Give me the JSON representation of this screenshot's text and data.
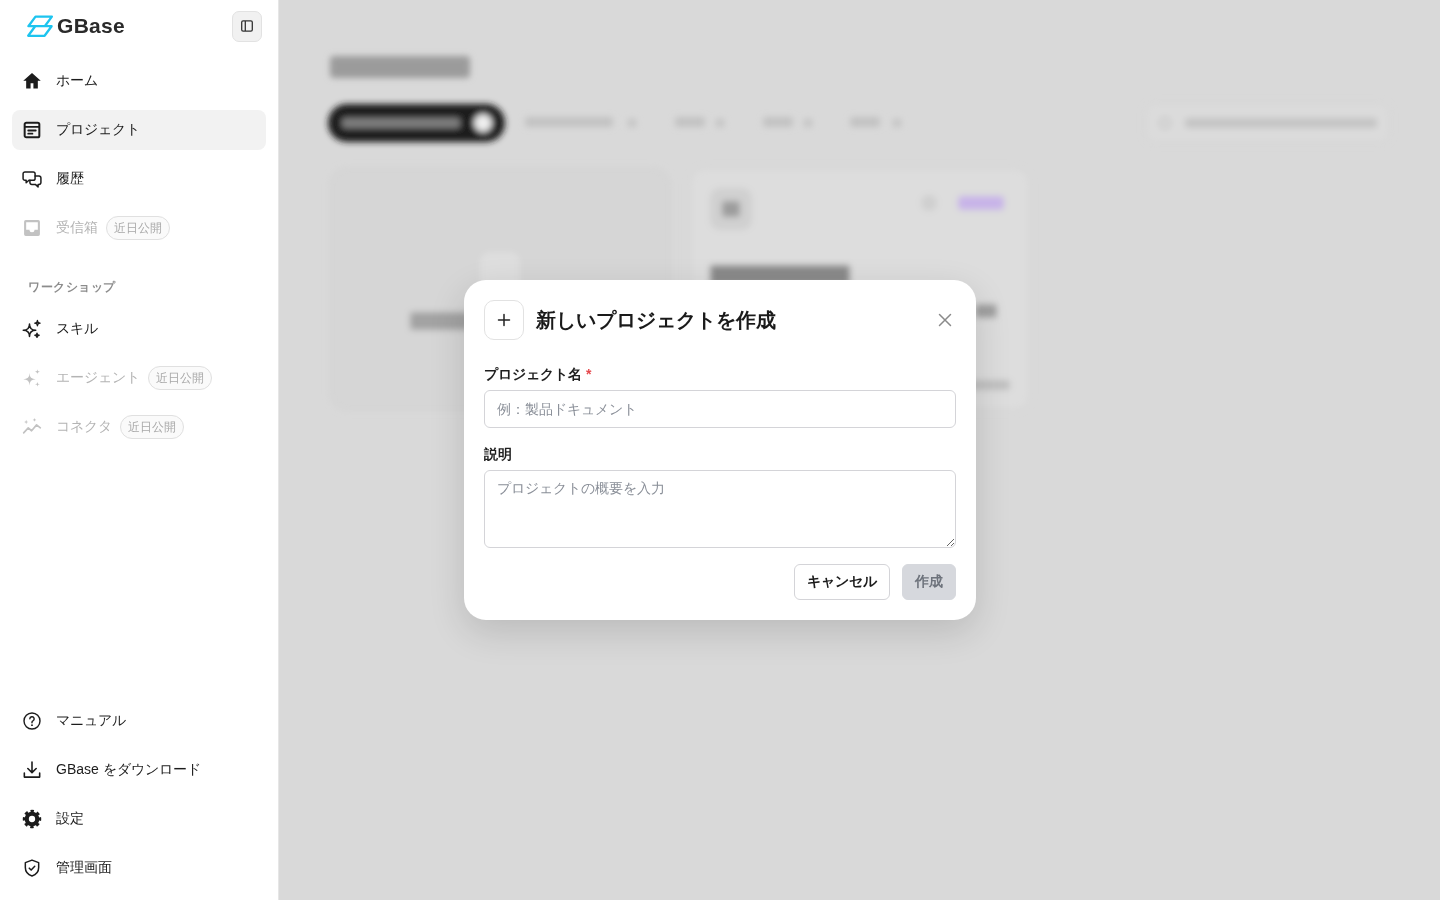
{
  "sidebar": {
    "brand": "GBase",
    "items": [
      {
        "label": "ホーム",
        "selected": false,
        "disabled": false
      },
      {
        "label": "プロジェクト",
        "selected": true,
        "disabled": false
      },
      {
        "label": "履歴",
        "selected": false,
        "disabled": false
      },
      {
        "label": "受信箱",
        "selected": false,
        "disabled": true,
        "badge": "近日公開"
      }
    ],
    "section": {
      "title": "ワークショップ",
      "items": [
        {
          "label": "スキル",
          "selected": false,
          "disabled": false
        },
        {
          "label": "エージェント",
          "selected": false,
          "disabled": true,
          "badge": "近日公開"
        },
        {
          "label": "コネクタ",
          "selected": false,
          "disabled": true,
          "badge": "近日公開"
        }
      ]
    },
    "footer_items": [
      {
        "label": "マニュアル",
        "selected": false,
        "disabled": false
      },
      {
        "label": "GBase をダウンロード",
        "selected": false,
        "disabled": false
      },
      {
        "label": "設定",
        "selected": false,
        "disabled": false
      },
      {
        "label": "管理画面",
        "selected": false,
        "disabled": false
      }
    ]
  },
  "dialog": {
    "title": "新しいプロジェクトを作成",
    "fields": [
      {
        "kind": "input",
        "label": "プロジェクト名",
        "required_mark": "*",
        "placeholder": "例：製品ドキュメント"
      },
      {
        "kind": "textarea",
        "label": "説明",
        "placeholder": "プロジェクトの概要を入力"
      }
    ],
    "buttons": [
      {
        "kind": "secondary",
        "label": "キャンセル",
        "disabled": false
      },
      {
        "kind": "primary",
        "label": "作成",
        "disabled": true
      }
    ]
  }
}
